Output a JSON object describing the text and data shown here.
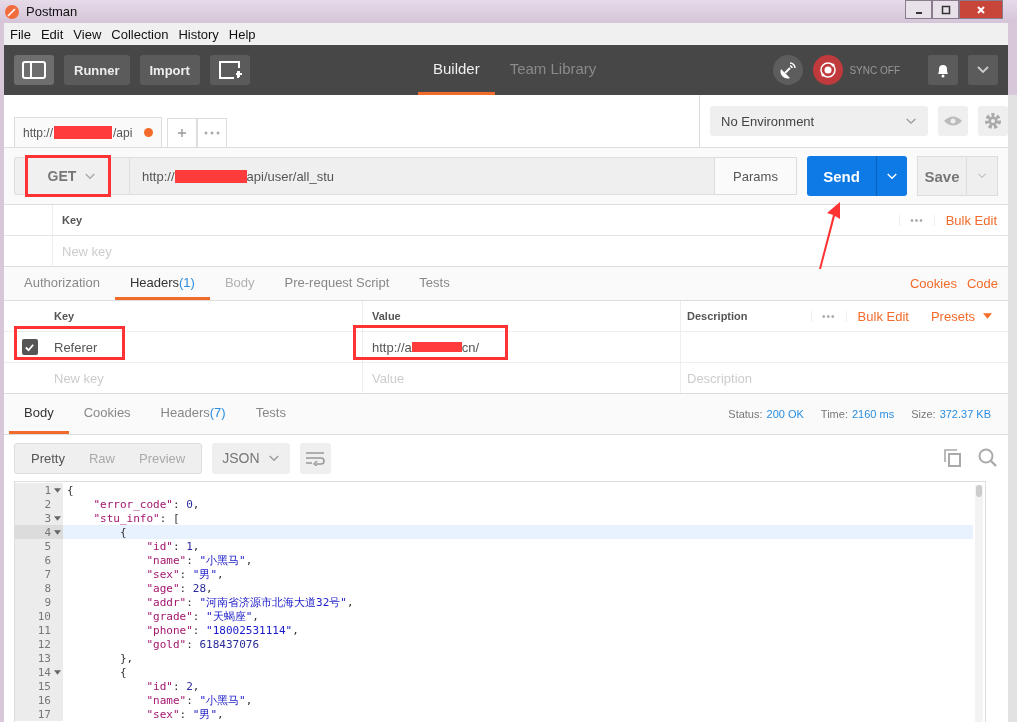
{
  "window": {
    "title": "Postman"
  },
  "menu": [
    "File",
    "Edit",
    "View",
    "Collection",
    "History",
    "Help"
  ],
  "toolbar": {
    "buttons": [
      "Runner",
      "Import"
    ],
    "sync": "SYNC OFF"
  },
  "main_tabs": [
    {
      "label": "Builder",
      "selected": true
    },
    {
      "label": "Team Library",
      "selected": false
    }
  ],
  "request_tab": {
    "label_start": "http://",
    "label_end": "/api",
    "unsaved": true
  },
  "environment": "No Environment",
  "request": {
    "method": "GET",
    "url_start": "http://",
    "url_end": "api/user/all_stu",
    "params": "Params",
    "send": "Send",
    "save": "Save"
  },
  "params_table": {
    "column": "Key",
    "more": "•••",
    "bulk_edit": "Bulk Edit",
    "placeholder": "New key"
  },
  "request_tabs": [
    {
      "label": "Authorization",
      "selected": false,
      "disabled": false
    },
    {
      "label": "Headers",
      "count": "(1)",
      "selected": true,
      "disabled": false
    },
    {
      "label": "Body",
      "selected": false,
      "disabled": true
    },
    {
      "label": "Pre-request Script",
      "selected": false,
      "disabled": false
    },
    {
      "label": "Tests",
      "selected": false,
      "disabled": false
    }
  ],
  "request_links": [
    "Cookies",
    "Code"
  ],
  "headers_table": {
    "columns": [
      "Key",
      "Value",
      "Description"
    ],
    "more": "•••",
    "bulk_edit": "Bulk Edit",
    "presets": "Presets",
    "rows": [
      {
        "checked": true,
        "key": "Referer",
        "value_start": "http://a",
        "value_end": "cn/"
      }
    ],
    "placeholders": [
      "New key",
      "Value",
      "Description"
    ]
  },
  "response_tabs": [
    {
      "label": "Body",
      "selected": true
    },
    {
      "label": "Cookies",
      "selected": false
    },
    {
      "label": "Headers",
      "count": "(7)",
      "selected": false
    },
    {
      "label": "Tests",
      "selected": false
    }
  ],
  "status": [
    {
      "label": "Status:",
      "value": "200 OK"
    },
    {
      "label": "Time:",
      "value": "2160 ms"
    },
    {
      "label": "Size:",
      "value": "372.37 KB"
    }
  ],
  "view_modes": [
    {
      "label": "Pretty",
      "selected": true
    },
    {
      "label": "Raw",
      "selected": false
    },
    {
      "label": "Preview",
      "selected": false
    }
  ],
  "format": "JSON",
  "code_lines": [
    {
      "n": "1",
      "fold": true,
      "active": false,
      "tokens": [
        {
          "kind": "punct",
          "text": "{"
        }
      ]
    },
    {
      "n": "2",
      "fold": false,
      "active": false,
      "tokens": [
        {
          "kind": "key",
          "text": "    \"error_code\""
        },
        {
          "kind": "punct",
          "text": ": "
        },
        {
          "kind": "num",
          "text": "0"
        },
        {
          "kind": "punct",
          "text": ","
        }
      ]
    },
    {
      "n": "3",
      "fold": true,
      "active": false,
      "tokens": [
        {
          "kind": "key",
          "text": "    \"stu_info\""
        },
        {
          "kind": "punct",
          "text": ": ["
        }
      ]
    },
    {
      "n": "4",
      "fold": true,
      "active": true,
      "tokens": [
        {
          "kind": "punct",
          "text": "        {"
        }
      ]
    },
    {
      "n": "5",
      "fold": false,
      "active": false,
      "tokens": [
        {
          "kind": "key",
          "text": "            \"id\""
        },
        {
          "kind": "punct",
          "text": ": "
        },
        {
          "kind": "num",
          "text": "1"
        },
        {
          "kind": "punct",
          "text": ","
        }
      ]
    },
    {
      "n": "6",
      "fold": false,
      "active": false,
      "tokens": [
        {
          "kind": "key",
          "text": "            \"name\""
        },
        {
          "kind": "punct",
          "text": ": "
        },
        {
          "kind": "str",
          "text": "\"小黑马\""
        },
        {
          "kind": "punct",
          "text": ","
        }
      ]
    },
    {
      "n": "7",
      "fold": false,
      "active": false,
      "tokens": [
        {
          "kind": "key",
          "text": "            \"sex\""
        },
        {
          "kind": "punct",
          "text": ": "
        },
        {
          "kind": "str",
          "text": "\"男\""
        },
        {
          "kind": "punct",
          "text": ","
        }
      ]
    },
    {
      "n": "8",
      "fold": false,
      "active": false,
      "tokens": [
        {
          "kind": "key",
          "text": "            \"age\""
        },
        {
          "kind": "punct",
          "text": ": "
        },
        {
          "kind": "num",
          "text": "28"
        },
        {
          "kind": "punct",
          "text": ","
        }
      ]
    },
    {
      "n": "9",
      "fold": false,
      "active": false,
      "tokens": [
        {
          "kind": "key",
          "text": "            \"addr\""
        },
        {
          "kind": "punct",
          "text": ": "
        },
        {
          "kind": "str",
          "text": "\"河南省济源市北海大道32号\""
        },
        {
          "kind": "punct",
          "text": ","
        }
      ]
    },
    {
      "n": "10",
      "fold": false,
      "active": false,
      "tokens": [
        {
          "kind": "key",
          "text": "            \"grade\""
        },
        {
          "kind": "punct",
          "text": ": "
        },
        {
          "kind": "str",
          "text": "\"天蝎座\""
        },
        {
          "kind": "punct",
          "text": ","
        }
      ]
    },
    {
      "n": "11",
      "fold": false,
      "active": false,
      "tokens": [
        {
          "kind": "key",
          "text": "            \"phone\""
        },
        {
          "kind": "punct",
          "text": ": "
        },
        {
          "kind": "str",
          "text": "\"18002531114\""
        },
        {
          "kind": "punct",
          "text": ","
        }
      ]
    },
    {
      "n": "12",
      "fold": false,
      "active": false,
      "tokens": [
        {
          "kind": "key",
          "text": "            \"gold\""
        },
        {
          "kind": "punct",
          "text": ": "
        },
        {
          "kind": "num",
          "text": "618437076"
        }
      ]
    },
    {
      "n": "13",
      "fold": false,
      "active": false,
      "tokens": [
        {
          "kind": "punct",
          "text": "        },"
        }
      ]
    },
    {
      "n": "14",
      "fold": true,
      "active": false,
      "tokens": [
        {
          "kind": "punct",
          "text": "        {"
        }
      ]
    },
    {
      "n": "15",
      "fold": false,
      "active": false,
      "tokens": [
        {
          "kind": "key",
          "text": "            \"id\""
        },
        {
          "kind": "punct",
          "text": ": "
        },
        {
          "kind": "num",
          "text": "2"
        },
        {
          "kind": "punct",
          "text": ","
        }
      ]
    },
    {
      "n": "16",
      "fold": false,
      "active": false,
      "tokens": [
        {
          "kind": "key",
          "text": "            \"name\""
        },
        {
          "kind": "punct",
          "text": ": "
        },
        {
          "kind": "str",
          "text": "\"小黑马\""
        },
        {
          "kind": "punct",
          "text": ","
        }
      ]
    },
    {
      "n": "17",
      "fold": false,
      "active": false,
      "tokens": [
        {
          "kind": "key",
          "text": "            \"sex\""
        },
        {
          "kind": "punct",
          "text": ": "
        },
        {
          "kind": "str",
          "text": "\"男\""
        },
        {
          "kind": "punct",
          "text": ","
        }
      ]
    }
  ]
}
